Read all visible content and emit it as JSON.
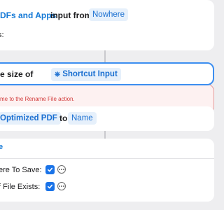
{
  "card1": {
    "title_fragment": "DFs and Apps",
    "mid_text": "input from",
    "source_token": "Nowhere",
    "second_line": "s:"
  },
  "card2": {
    "text": "e size of",
    "token_icon": "shortcut-input-icon",
    "token_glyph": "⎈",
    "token_label": "Shortcut Input"
  },
  "error": {
    "message": "me to the Rename File action."
  },
  "card3": {
    "token_left": "Optimized PDF",
    "mid_text": "to",
    "token_right": "Name"
  },
  "card4": {
    "top_line": "e",
    "option1_label": "ere To Save:",
    "option1_checked": true,
    "option2_label": "f File Exists:",
    "option2_checked": true
  },
  "colors": {
    "accent": "#1a73e8",
    "token_bg": "#e6f0fb",
    "error_text": "#d23b3b",
    "error_border": "#e59d9d"
  }
}
